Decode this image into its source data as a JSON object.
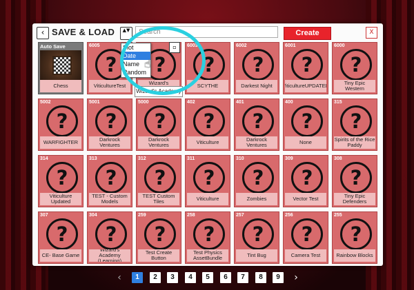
{
  "header": {
    "back_icon": "‹",
    "title": "SAVE & LOAD",
    "sort_icon": "▲▼",
    "search_placeholder": "Search",
    "create_label": "Create",
    "close_label": "X"
  },
  "sort_dropdown": {
    "options": [
      "Slot",
      "Date",
      "Name",
      "Random"
    ],
    "selected": "Date"
  },
  "tooltip": "Wizard's Academy",
  "tiles": [
    {
      "id": "Auto Save",
      "label": "Chess",
      "auto": true
    },
    {
      "id": "6005",
      "label": "ViticultureTest"
    },
    {
      "id": "6004",
      "label": "Wizard's Academy"
    },
    {
      "id": "6003",
      "label": "SCYTHE"
    },
    {
      "id": "6002",
      "label": "Darkest Night"
    },
    {
      "id": "6001",
      "label": "ViticultureUPDATED"
    },
    {
      "id": "6000",
      "label": "Tiny Epic Western"
    },
    {
      "id": "5002",
      "label": "WARFIGHTER"
    },
    {
      "id": "5001",
      "label": "Darkrock Ventures"
    },
    {
      "id": "5000",
      "label": "Darkrock Ventures"
    },
    {
      "id": "402",
      "label": "Viticulture"
    },
    {
      "id": "401",
      "label": "Darkrock Ventures"
    },
    {
      "id": "400",
      "label": "None"
    },
    {
      "id": "315",
      "label": "Spirits of the Rice Paddy"
    },
    {
      "id": "314",
      "label": "Viticulture Updated"
    },
    {
      "id": "313",
      "label": "TEST - Custom Models"
    },
    {
      "id": "312",
      "label": "TEST  Custom Tiles"
    },
    {
      "id": "311",
      "label": "Viticulture"
    },
    {
      "id": "310",
      "label": "Zombies"
    },
    {
      "id": "309",
      "label": "Vector Test"
    },
    {
      "id": "308",
      "label": "Tiny Epic Defenders"
    },
    {
      "id": "307",
      "label": "CE- Base Game"
    },
    {
      "id": "304",
      "label": "Wizard's Academy (Learning)"
    },
    {
      "id": "259",
      "label": "Test Create Button"
    },
    {
      "id": "258",
      "label": "Test Physics AssetBundle"
    },
    {
      "id": "257",
      "label": "Tint Bug"
    },
    {
      "id": "256",
      "label": "Camera Test"
    },
    {
      "id": "255",
      "label": "Rainbow Blocks"
    }
  ],
  "qmark": "?",
  "pagination": {
    "prev": "‹",
    "next": "›",
    "pages": [
      "1",
      "2",
      "3",
      "4",
      "5",
      "6",
      "7",
      "8",
      "9"
    ],
    "current": "1"
  },
  "colors": {
    "accent": "#2f7fe0",
    "create": "#e8232b",
    "tile": "#d86a6c",
    "highlight_ring": "#2ad0e0"
  }
}
